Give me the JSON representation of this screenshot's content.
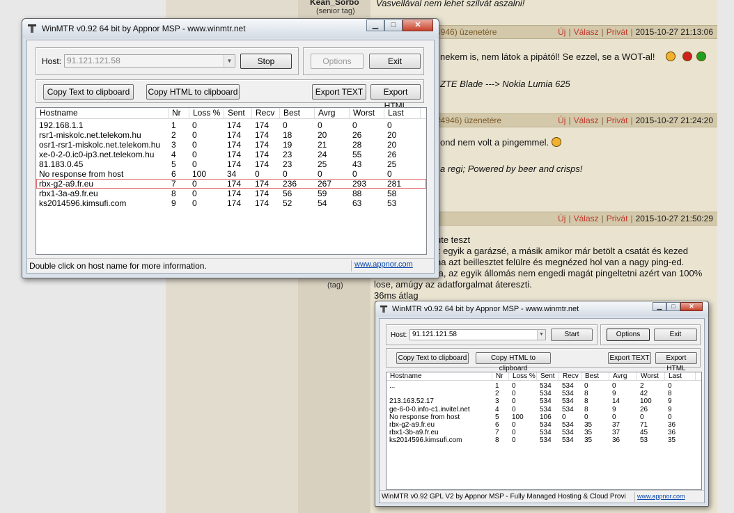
{
  "forum": {
    "user_top_name": "Kean_Sorbo",
    "user_top_rank": "(senior tag)",
    "user_bottom_rank": "(tag)",
    "post1_text": "Vasvellával nem lehet szilvát aszalni!",
    "headers": [
      {
        "ref": "4946) üzenetére",
        "date": "2015-10-27 21:13:06"
      },
      {
        "ref": "#4946) üzenetére",
        "date": "2015-10-27 21:24:20"
      },
      {
        "ref": "",
        "date": "2015-10-27 21:50:29"
      }
    ],
    "actions": [
      "Új",
      "Válasz",
      "Privát"
    ],
    "post2_text": "nekem is, nem látok a pipától! Se ezzel, se a WOT-al!",
    "post2_sig": "ZTE Blade ---> Nokia Lumia 625",
    "post3_text": "ond nem volt a pingemmel.",
    "post3_sig": "a regi; Powered by beer and crisps!",
    "post4_lines": [
      "ute teszt",
      "z egyik a garázsé, a másik amikor már betölt a csatát és kezed",
      "na azt beillesztet felülre és megnézed hol van a nagy ping-ed.",
      "ta, az egyik állomás nem engedi magát pingeltetni azért van 100%",
      "lose, amúgy az adatforgalmat átereszti.",
      "36ms átlag"
    ]
  },
  "win1": {
    "title": "WinMTR v0.92 64 bit by Appnor MSP - www.winmtr.net",
    "host_label": "Host:",
    "host_value": "91.121.121.58",
    "stop_label": "Stop",
    "options_label": "Options",
    "exit_label": "Exit",
    "copy_text_label": "Copy Text to clipboard",
    "copy_html_label": "Copy HTML to clipboard",
    "export_text_label": "Export TEXT",
    "export_html_label": "Export HTML",
    "columns": [
      "Hostname",
      "Nr",
      "Loss %",
      "Sent",
      "Recv",
      "Best",
      "Avrg",
      "Worst",
      "Last"
    ],
    "rows": [
      [
        "192.168.1.1",
        "1",
        "0",
        "174",
        "174",
        "0",
        "0",
        "0",
        "0"
      ],
      [
        "rsr1-miskolc.net.telekom.hu",
        "2",
        "0",
        "174",
        "174",
        "18",
        "20",
        "26",
        "20"
      ],
      [
        "osr1-rsr1-miskolc.net.telekom.hu",
        "3",
        "0",
        "174",
        "174",
        "19",
        "21",
        "28",
        "20"
      ],
      [
        "xe-0-2-0.ic0-ip3.net.telekom.hu",
        "4",
        "0",
        "174",
        "174",
        "23",
        "24",
        "55",
        "26"
      ],
      [
        "81.183.0.45",
        "5",
        "0",
        "174",
        "174",
        "23",
        "25",
        "43",
        "25"
      ],
      [
        "No response from host",
        "6",
        "100",
        "34",
        "0",
        "0",
        "0",
        "0",
        "0"
      ],
      [
        "rbx-g2-a9.fr.eu",
        "7",
        "0",
        "174",
        "174",
        "236",
        "267",
        "293",
        "281"
      ],
      [
        "rbx1-3a-a9.fr.eu",
        "8",
        "0",
        "174",
        "174",
        "56",
        "59",
        "88",
        "58"
      ],
      [
        "ks2014596.kimsufi.com",
        "9",
        "0",
        "174",
        "174",
        "52",
        "54",
        "63",
        "53"
      ]
    ],
    "status_text": "Double click on host name for more information.",
    "status_link": "www.appnor.com"
  },
  "win2": {
    "title": "WinMTR v0.92 64 bit by Appnor MSP - www.winmtr.net",
    "host_label": "Host:",
    "host_value": "91.121.121.58",
    "start_label": "Start",
    "options_label": "Options",
    "exit_label": "Exit",
    "copy_text_label": "Copy Text to clipboard",
    "copy_html_label": "Copy HTML to clipboard",
    "export_text_label": "Export TEXT",
    "export_html_label": "Export HTML",
    "columns": [
      "Hostname",
      "Nr",
      "Loss %",
      "Sent",
      "Recv",
      "Best",
      "Avrg",
      "Worst",
      "Last"
    ],
    "rows": [
      [
        "...",
        "1",
        "0",
        "534",
        "534",
        "0",
        "0",
        "2",
        "0"
      ],
      [
        "",
        "2",
        "0",
        "534",
        "534",
        "8",
        "9",
        "42",
        "8"
      ],
      [
        "213.163.52.17",
        "3",
        "0",
        "534",
        "534",
        "8",
        "14",
        "100",
        "9"
      ],
      [
        "ge-6-0-0.info-c1.invitel.net",
        "4",
        "0",
        "534",
        "534",
        "8",
        "9",
        "26",
        "9"
      ],
      [
        "No response from host",
        "5",
        "100",
        "106",
        "0",
        "0",
        "0",
        "0",
        "0"
      ],
      [
        "rbx-g2-a9.fr.eu",
        "6",
        "0",
        "534",
        "534",
        "35",
        "37",
        "71",
        "36"
      ],
      [
        "rbx1-3b-a9.fr.eu",
        "7",
        "0",
        "534",
        "534",
        "35",
        "37",
        "45",
        "36"
      ],
      [
        "ks2014596.kimsufi.com",
        "8",
        "0",
        "534",
        "534",
        "35",
        "36",
        "53",
        "35"
      ]
    ],
    "status_text": "WinMTR v0.92 GPL V2 by Appnor MSP - Fully Managed Hosting & Cloud Provi",
    "status_link": "www.appnor.com"
  }
}
